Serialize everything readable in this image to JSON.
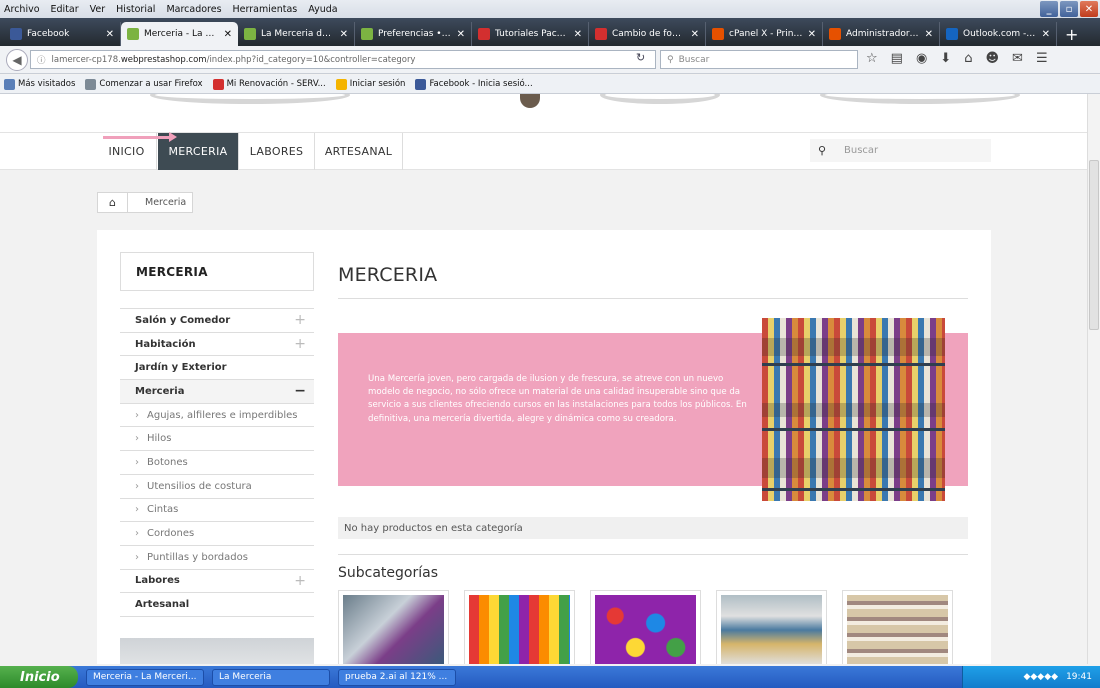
{
  "browser": {
    "menu": [
      "Archivo",
      "Editar",
      "Ver",
      "Historial",
      "Marcadores",
      "Herramientas",
      "Ayuda"
    ],
    "tabs": [
      {
        "label": "Facebook",
        "color": "#3b5998",
        "active": false
      },
      {
        "label": "Merceria - La Mer...",
        "color": "#7cb342",
        "active": true
      },
      {
        "label": "La Merceria de M...",
        "color": "#7cb342",
        "active": false
      },
      {
        "label": "Preferencias • La ...",
        "color": "#7cb342",
        "active": false
      },
      {
        "label": "Tutoriales Packs ...",
        "color": "#d32f2f",
        "active": false
      },
      {
        "label": "Cambio de fondo (...",
        "color": "#d32f2f",
        "active": false
      },
      {
        "label": "cPanel X - Principal",
        "color": "#e65100",
        "active": false
      },
      {
        "label": "Administrador de a...",
        "color": "#e65100",
        "active": false
      },
      {
        "label": "Outlook.com - julia...",
        "color": "#1565c0",
        "active": false
      }
    ],
    "url_prefix": "lamercer-cp178.",
    "url_domain": "webprestashop.com",
    "url_rest": "/index.php?id_category=10&controller=category",
    "search_placeholder": "Buscar",
    "bookmarks": [
      {
        "label": "Más visitados",
        "color": "#5a7fb8"
      },
      {
        "label": "Comenzar a usar Firefox",
        "color": "#7d8a96"
      },
      {
        "label": "Mi Renovación - SERV...",
        "color": "#d32f2f"
      },
      {
        "label": "Iniciar sesión",
        "color": "#f4b400"
      },
      {
        "label": "Facebook - Inicia sesió...",
        "color": "#3b5998"
      }
    ]
  },
  "shop": {
    "menu": [
      "INICIO",
      "MERCERIA",
      "LABORES",
      "ARTESANAL"
    ],
    "search_placeholder": "Buscar",
    "breadcrumb": "Merceria",
    "sidebar_title": "MERCERIA",
    "categories": [
      {
        "label": "Salón y Comedor",
        "type": "plus"
      },
      {
        "label": "Habitación",
        "type": "plus"
      },
      {
        "label": "Jardín y Exterior",
        "type": "none"
      },
      {
        "label": "Merceria",
        "type": "minus"
      },
      {
        "label": "Agujas, alfileres e imperdibles",
        "type": "sub"
      },
      {
        "label": "Hilos",
        "type": "sub"
      },
      {
        "label": "Botones",
        "type": "sub"
      },
      {
        "label": "Utensilios de costura",
        "type": "sub"
      },
      {
        "label": "Cintas",
        "type": "sub"
      },
      {
        "label": "Cordones",
        "type": "sub"
      },
      {
        "label": "Puntillas y bordados",
        "type": "sub"
      },
      {
        "label": "Labores",
        "type": "plus"
      },
      {
        "label": "Artesanal",
        "type": "none"
      }
    ],
    "title": "MERCERIA",
    "description": "Una Mercería joven, pero cargada de ilusion y de frescura, se atreve con un nuevo modelo de negocio, no sólo ofrece un material de una calidad insuperable sino que da servicio a sus clientes ofreciendo cursos en las instalaciones para todos los públicos. En definitiva, una mercería divertida, alegre y dinámica como su creadora.",
    "no_products": "No hay productos en esta categoría",
    "subcategories_title": "Subcategorías",
    "accent_pink": "#f0a3bd",
    "menu_active_bg": "#3e4b53"
  },
  "taskbar": {
    "start": "Inicio",
    "items": [
      "Merceria - La Merceri...",
      "La Merceria",
      "prueba 2.ai al 121% ..."
    ],
    "clock": "19:41"
  }
}
